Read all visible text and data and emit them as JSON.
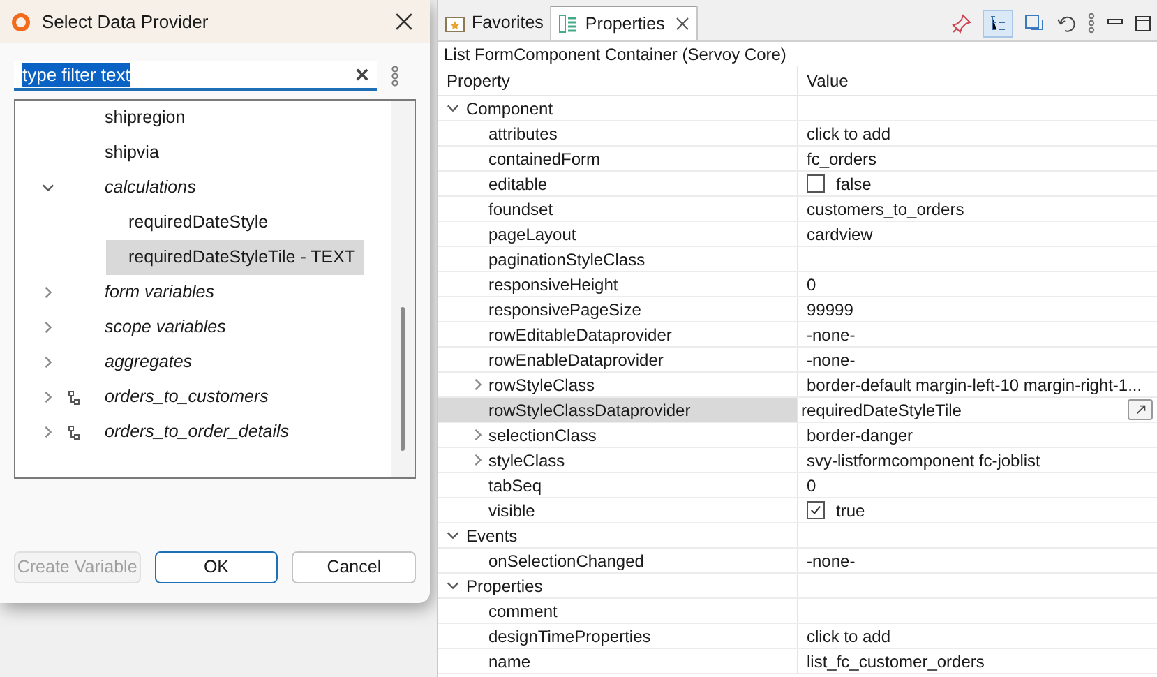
{
  "dialog": {
    "title": "Select Data Provider",
    "filter": {
      "value": "type filter text"
    },
    "tree": [
      {
        "label": "shipregion",
        "selected": false
      },
      {
        "label": "shipvia",
        "selected": false
      },
      {
        "label": "calculations",
        "kind": "group",
        "expanded": true,
        "selected": false,
        "children": [
          {
            "label": "requiredDateStyle",
            "selected": false
          },
          {
            "label": "requiredDateStyleTile - TEXT",
            "selected": true
          }
        ]
      },
      {
        "label": "form variables",
        "kind": "group",
        "expanded": false,
        "selected": false
      },
      {
        "label": "scope variables",
        "kind": "group",
        "expanded": false,
        "selected": false
      },
      {
        "label": "aggregates",
        "kind": "group",
        "expanded": false,
        "selected": false
      },
      {
        "label": "orders_to_customers",
        "kind": "relation",
        "expanded": false,
        "selected": false
      },
      {
        "label": "orders_to_order_details",
        "kind": "relation",
        "expanded": false,
        "selected": false
      }
    ],
    "buttons": [
      {
        "label": "Create Variable",
        "disabled": true,
        "default": false
      },
      {
        "label": "OK",
        "disabled": false,
        "default": true
      },
      {
        "label": "Cancel",
        "disabled": false,
        "default": false
      }
    ]
  },
  "properties_panel": {
    "tabs": [
      {
        "label": "Favorites",
        "selected": false,
        "kind": "favorites"
      },
      {
        "label": "Properties",
        "selected": true,
        "kind": "properties"
      }
    ],
    "title": "List FormComponent Container (Servoy Core)",
    "columns": [
      "Property",
      "Value"
    ],
    "rows": [
      {
        "kind": "category",
        "label": "Component",
        "expanded": true
      },
      {
        "kind": "property",
        "name": "attributes",
        "value": "click to add",
        "selected": false
      },
      {
        "kind": "property",
        "name": "containedForm",
        "value": "fc_orders",
        "selected": false
      },
      {
        "kind": "checkbox",
        "name": "editable",
        "value": "false",
        "checked": false,
        "selected": false
      },
      {
        "kind": "property",
        "name": "foundset",
        "value": "customers_to_orders",
        "selected": false
      },
      {
        "kind": "property",
        "name": "pageLayout",
        "value": "cardview",
        "selected": false
      },
      {
        "kind": "property",
        "name": "paginationStyleClass",
        "selected": false
      },
      {
        "kind": "property",
        "name": "responsiveHeight",
        "value": "0",
        "selected": false
      },
      {
        "kind": "property",
        "name": "responsivePageSize",
        "value": "99999",
        "selected": false
      },
      {
        "kind": "property",
        "name": "rowEditableDataprovider",
        "value": "-none-",
        "selected": false
      },
      {
        "kind": "property",
        "name": "rowEnableDataprovider",
        "value": "-none-",
        "selected": false
      },
      {
        "kind": "property",
        "name": "rowStyleClass",
        "value": "border-default margin-left-10 margin-right-1...",
        "expanded": false,
        "selected": false
      },
      {
        "kind": "property",
        "name": "rowStyleClassDataprovider",
        "value": "requiredDateStyleTile",
        "selected": true
      },
      {
        "kind": "property",
        "name": "selectionClass",
        "value": "border-danger",
        "expanded": false,
        "selected": false
      },
      {
        "kind": "property",
        "name": "styleClass",
        "value": "svy-listformcomponent fc-joblist",
        "expanded": false,
        "selected": false
      },
      {
        "kind": "property",
        "name": "tabSeq",
        "value": "0",
        "selected": false
      },
      {
        "kind": "checkbox",
        "name": "visible",
        "value": "true",
        "checked": true,
        "selected": false
      },
      {
        "kind": "category",
        "label": "Events",
        "expanded": true
      },
      {
        "kind": "property",
        "name": "onSelectionChanged",
        "value": "-none-",
        "selected": false
      },
      {
        "kind": "category",
        "label": "Properties",
        "expanded": true
      },
      {
        "kind": "property",
        "name": "comment",
        "selected": false
      },
      {
        "kind": "property",
        "name": "designTimeProperties",
        "value": "click to add",
        "selected": false
      },
      {
        "kind": "property",
        "name": "name",
        "value": "list_fc_customer_orders",
        "selected": false
      }
    ]
  }
}
